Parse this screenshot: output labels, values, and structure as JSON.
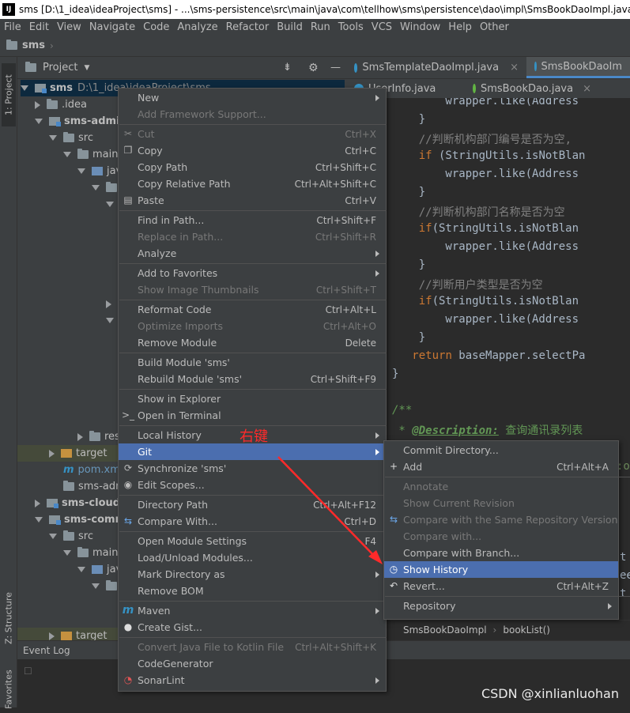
{
  "window": {
    "title": "sms [D:\\1_idea\\ideaProject\\sms] - ...\\sms-persistence\\src\\main\\java\\com\\tellhow\\sms\\persistence\\dao\\impl\\SmsBookDaoImpl.java [s",
    "app_icon": "IJ"
  },
  "menubar": [
    "File",
    "Edit",
    "View",
    "Navigate",
    "Code",
    "Analyze",
    "Refactor",
    "Build",
    "Run",
    "Tools",
    "VCS",
    "Window",
    "Help",
    "Other"
  ],
  "navbar": {
    "project": "sms"
  },
  "side_tabs": {
    "project": "1: Project",
    "structure": "Z: Structure",
    "favorites": "Favorites"
  },
  "project_panel": {
    "title": "Project",
    "tree": [
      {
        "label": "sms",
        "extra": "D:\\1_idea\\ideaProject\\sms"
      },
      {
        "label": ".idea"
      },
      {
        "label": "sms-admin"
      },
      {
        "label": "src"
      },
      {
        "label": "main"
      },
      {
        "label": "java"
      },
      {
        "label": "res"
      },
      {
        "label": "target"
      },
      {
        "label": "pom.xml"
      },
      {
        "label": "sms-adm"
      },
      {
        "label": "sms-cloud-s"
      },
      {
        "label": "sms-comm"
      },
      {
        "label": "src"
      },
      {
        "label": "main"
      },
      {
        "label": "java"
      },
      {
        "label": "target"
      }
    ]
  },
  "editor": {
    "tabs_row1": [
      "SmsTemplateDaoImpl.java",
      "SmsBookDaoIm"
    ],
    "tabs_row2": [
      "UserInfo.java",
      "SmsBookDao.java"
    ],
    "code_lines": [
      {
        "t": "        wrapper.like(Address",
        "c": "id"
      },
      {
        "t": "    }",
        "c": "id"
      },
      {
        "t": "    //判断机构部门编号是否为空,",
        "c": "cm"
      },
      {
        "t": "    if (StringUtils.isNotBlan",
        "c": "kw_if"
      },
      {
        "t": "        wrapper.like(Address",
        "c": "id"
      },
      {
        "t": "    }",
        "c": "id"
      },
      {
        "t": "    //判断机构部门名称是否为空",
        "c": "cm"
      },
      {
        "t": "    if(StringUtils.isNotBlan",
        "c": "kw_if"
      },
      {
        "t": "        wrapper.like(Address",
        "c": "id"
      },
      {
        "t": "    }",
        "c": "id"
      },
      {
        "t": "    //判断用户类型是否为空",
        "c": "cm"
      },
      {
        "t": "    if(StringUtils.isNotBlan",
        "c": "kw_if"
      },
      {
        "t": "        wrapper.like(Address",
        "c": "id"
      },
      {
        "t": "    }",
        "c": "id"
      },
      {
        "t": "   return baseMapper.selectPa",
        "c": "kw_ret"
      },
      {
        "t": "}",
        "c": "id"
      },
      {
        "t": "",
        "c": "id"
      },
      {
        "t": "/**",
        "c": "doc"
      },
      {
        "t": " * @Description: 查询通讯录列表",
        "c": "doc_tag"
      }
    ],
    "breadcrumb": [
      "SmsBookDaoImpl",
      "bookList()"
    ],
    "partial_right": [
      ":or",
      "t",
      "ee",
      "t"
    ]
  },
  "bottom": {
    "event_log": "Event Log"
  },
  "watermark": "CSDN @xinlianluohan",
  "annotation": {
    "label": "右键"
  },
  "context_menu": [
    {
      "label": "New",
      "sub": true
    },
    {
      "label": "Add Framework Support...",
      "disabled": true
    },
    {
      "sep": true
    },
    {
      "label": "Cut",
      "shortcut": "Ctrl+X",
      "icon": "cut-icon",
      "disabled": true
    },
    {
      "label": "Copy",
      "shortcut": "Ctrl+C",
      "icon": "copy-icon"
    },
    {
      "label": "Copy Path",
      "shortcut": "Ctrl+Shift+C"
    },
    {
      "label": "Copy Relative Path",
      "shortcut": "Ctrl+Alt+Shift+C"
    },
    {
      "label": "Paste",
      "shortcut": "Ctrl+V",
      "icon": "paste-icon"
    },
    {
      "sep": true
    },
    {
      "label": "Find in Path...",
      "shortcut": "Ctrl+Shift+F"
    },
    {
      "label": "Replace in Path...",
      "shortcut": "Ctrl+Shift+R",
      "disabled": true
    },
    {
      "label": "Analyze",
      "sub": true
    },
    {
      "sep": true
    },
    {
      "label": "Add to Favorites",
      "sub": true
    },
    {
      "label": "Show Image Thumbnails",
      "shortcut": "Ctrl+Shift+T",
      "disabled": true
    },
    {
      "sep": true
    },
    {
      "label": "Reformat Code",
      "shortcut": "Ctrl+Alt+L"
    },
    {
      "label": "Optimize Imports",
      "shortcut": "Ctrl+Alt+O",
      "disabled": true
    },
    {
      "label": "Remove Module",
      "shortcut": "Delete"
    },
    {
      "sep": true
    },
    {
      "label": "Build Module 'sms'"
    },
    {
      "label": "Rebuild Module 'sms'",
      "shortcut": "Ctrl+Shift+F9"
    },
    {
      "sep": true
    },
    {
      "label": "Show in Explorer"
    },
    {
      "label": "Open in Terminal",
      "icon": "terminal-icon"
    },
    {
      "sep": true
    },
    {
      "label": "Local History",
      "sub": true
    },
    {
      "label": "Git",
      "sub": true,
      "selected": true
    },
    {
      "label": "Synchronize 'sms'",
      "icon": "sync-icon"
    },
    {
      "label": "Edit Scopes...",
      "icon": "scopes-icon"
    },
    {
      "sep": true
    },
    {
      "label": "Directory Path",
      "shortcut": "Ctrl+Alt+F12"
    },
    {
      "label": "Compare With...",
      "shortcut": "Ctrl+D",
      "icon": "compare-icon"
    },
    {
      "sep": true
    },
    {
      "label": "Open Module Settings",
      "shortcut": "F4"
    },
    {
      "label": "Load/Unload Modules..."
    },
    {
      "label": "Mark Directory as",
      "sub": true
    },
    {
      "label": "Remove BOM"
    },
    {
      "sep": true
    },
    {
      "label": "Maven",
      "sub": true,
      "icon": "maven-icon"
    },
    {
      "label": "Create Gist...",
      "icon": "github-icon"
    },
    {
      "sep": true
    },
    {
      "label": "Convert Java File to Kotlin File",
      "shortcut": "Ctrl+Alt+Shift+K",
      "disabled": true
    },
    {
      "label": "CodeGenerator"
    },
    {
      "label": "SonarLint",
      "sub": true,
      "icon": "sonarlint-icon"
    }
  ],
  "git_menu": [
    {
      "label": "Commit Directory..."
    },
    {
      "label": "Add",
      "shortcut": "Ctrl+Alt+A",
      "icon": "add-icon"
    },
    {
      "sep": true
    },
    {
      "label": "Annotate",
      "disabled": true
    },
    {
      "label": "Show Current Revision",
      "disabled": true
    },
    {
      "label": "Compare with the Same Repository Version",
      "disabled": true,
      "icon": "compare-icon"
    },
    {
      "label": "Compare with...",
      "disabled": true
    },
    {
      "label": "Compare with Branch..."
    },
    {
      "label": "Show History",
      "selected": true,
      "icon": "history-icon"
    },
    {
      "label": "Revert...",
      "shortcut": "Ctrl+Alt+Z",
      "icon": "revert-icon"
    },
    {
      "sep": true
    },
    {
      "label": "Repository",
      "sub": true
    }
  ],
  "colors": {
    "accent": "#4b6eaf",
    "annotation": "#ff2a2a",
    "background": "#3c3f41"
  }
}
